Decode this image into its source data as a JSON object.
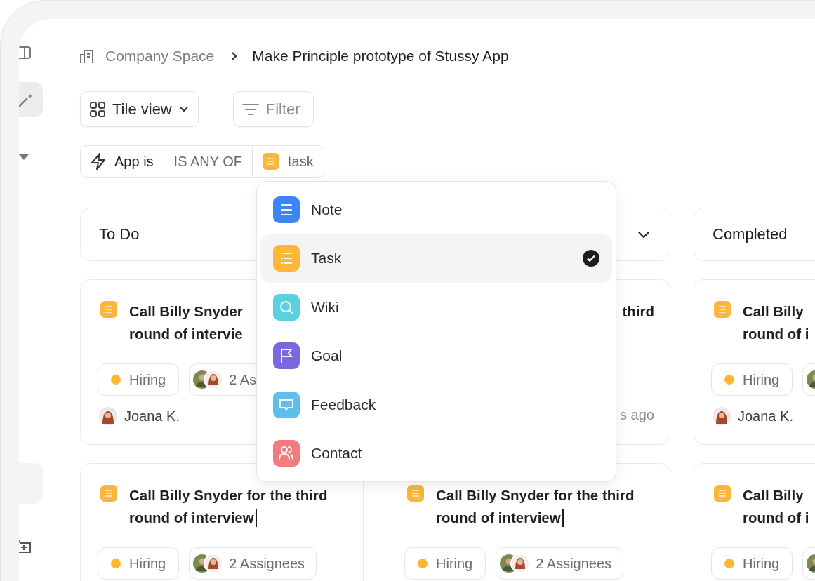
{
  "breadcrumb": {
    "parent": "Company Space",
    "current": "Make Principle prototype of Stussy App"
  },
  "toolbar": {
    "view_button": "Tile view",
    "filter_button": "Filter"
  },
  "filter_rule": {
    "field": "App is",
    "operator": "IS ANY OF",
    "value": "task"
  },
  "columns": [
    {
      "title": "To Do",
      "cards": [
        {
          "kind": "full",
          "title_lines": [
            "Call Billy Snyder",
            "round of intervie"
          ],
          "editing": false,
          "tag": {
            "label": "Hiring",
            "color": "#fbb731"
          },
          "assignee_chip": true,
          "assignees": "2 As",
          "author": "Joana K."
        },
        {
          "kind": "full",
          "title_lines": [
            "Call Billy Snyder for the third",
            "round of interview"
          ],
          "editing": true,
          "tag": {
            "label": "Hiring",
            "color": "#fbb731"
          },
          "assignee_chip": true,
          "assignees": "2 Assignees"
        }
      ]
    },
    {
      "chevron": true,
      "cards": [
        {
          "kind": "covered",
          "title_lines": [
            "third"
          ],
          "time": "s ago"
        },
        {
          "kind": "full",
          "title_lines": [
            "Call Billy Snyder for the third",
            "round of interview"
          ],
          "editing": true,
          "tag": {
            "label": "Hiring",
            "color": "#fbb731"
          },
          "assignee_chip": true,
          "assignees": "2 Assignees"
        }
      ]
    },
    {
      "title": "Completed",
      "cards": [
        {
          "kind": "full",
          "title_lines": [
            "Call Billy",
            "round of i"
          ],
          "editing": false,
          "tag": {
            "label": "Hiring",
            "color": "#fbb731"
          },
          "assignee_chip": true,
          "author": "Joana K."
        },
        {
          "kind": "full",
          "title_lines": [
            "Call Billy",
            "round of i"
          ],
          "editing": false,
          "tag": {
            "label": "Hiring",
            "color": "#fbb731"
          },
          "assignee_chip": true
        }
      ]
    }
  ],
  "dropdown": {
    "items": [
      {
        "kind": "note",
        "label": "Note",
        "color": "#3d84f5",
        "selected": false
      },
      {
        "kind": "task",
        "label": "Task",
        "color": "#fbb63b",
        "selected": true
      },
      {
        "kind": "wiki",
        "label": "Wiki",
        "color": "#5ccfe2",
        "selected": false
      },
      {
        "kind": "goal",
        "label": "Goal",
        "color": "#7a68de",
        "selected": false
      },
      {
        "kind": "feedback",
        "label": "Feedback",
        "color": "#5dbfea",
        "selected": false
      },
      {
        "kind": "contact",
        "label": "Contact",
        "color": "#f27b80",
        "selected": false
      }
    ]
  }
}
